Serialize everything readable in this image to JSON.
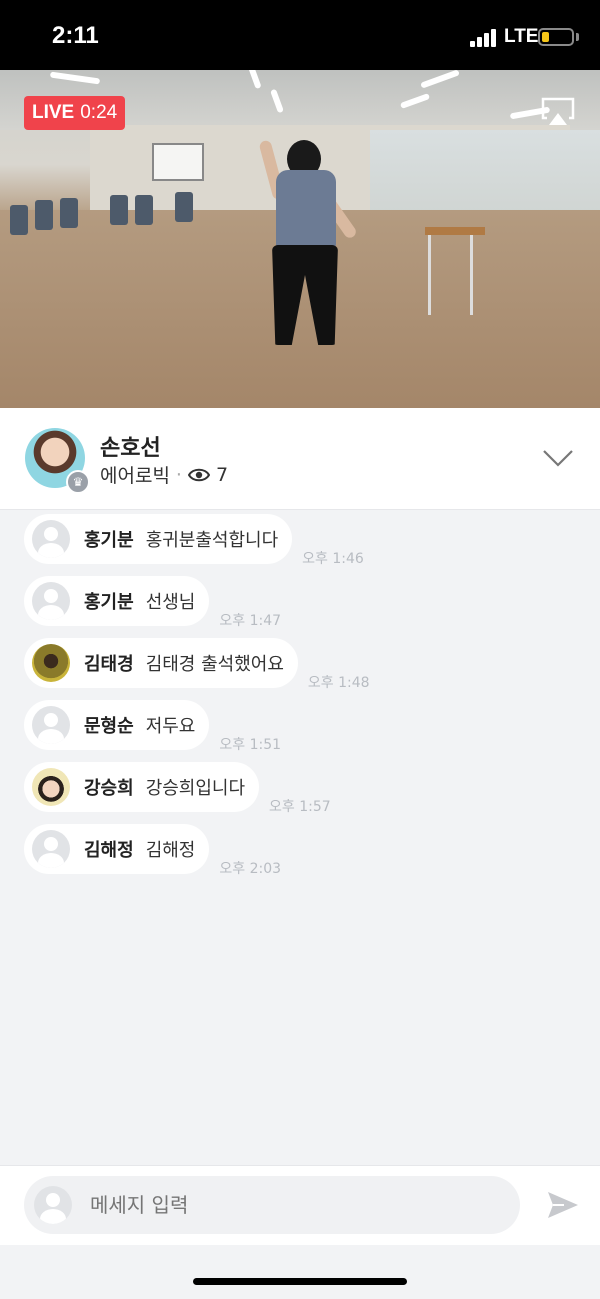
{
  "status_bar": {
    "time": "2:11",
    "network": "LTE"
  },
  "video": {
    "live_label": "LIVE",
    "duration": "0:24"
  },
  "host": {
    "name": "손호선",
    "category": "에어로빅",
    "separator": "·",
    "viewer_count": "7"
  },
  "chat": {
    "messages": [
      {
        "sender": "홍기분",
        "text": "홍귀분출석합니다",
        "time": "오후 1:46",
        "avatar": "default"
      },
      {
        "sender": "홍기분",
        "text": "선생님",
        "time": "오후 1:47",
        "avatar": "default"
      },
      {
        "sender": "김태경",
        "text": "김태경 출석했어요",
        "time": "오후 1:48",
        "avatar": "photo"
      },
      {
        "sender": "문형순",
        "text": "저두요",
        "time": "오후 1:51",
        "avatar": "default"
      },
      {
        "sender": "강승희",
        "text": "강승희입니다",
        "time": "오후 1:57",
        "avatar": "photo"
      },
      {
        "sender": "김해정",
        "text": "김해정",
        "time": "오후 2:03",
        "avatar": "default"
      }
    ]
  },
  "input": {
    "placeholder": "메세지 입력"
  },
  "colors": {
    "live": "#f0434b",
    "background": "#f2f3f5",
    "battery": "#f5c518"
  },
  "icons": [
    "airplay-icon",
    "eye-icon",
    "chevron-down-icon",
    "crown-icon",
    "send-icon",
    "signal-icon",
    "battery-icon"
  ]
}
